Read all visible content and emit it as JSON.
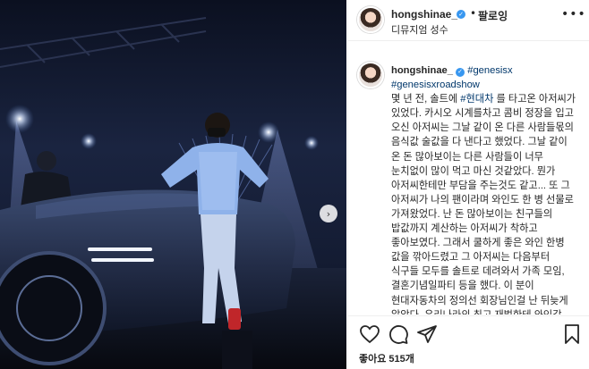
{
  "post": {
    "username": "hongshinae_",
    "verified_mark": "✓",
    "separator": "•",
    "follow_label": "팔로잉",
    "location": "디뮤지엄 성수",
    "more_icon": "more-options-icon",
    "next_arrow": "›"
  },
  "caption": {
    "username": "hongshinae_",
    "hashtags": "#genesisx",
    "hashtag_line2": "#genesisxroadshow",
    "body_part1": "몇 년 전, 솔트에 ",
    "body_tag": "#현대차",
    "body_part2": " 를 타고온 아저씨가 있었다. 카시오 시계를차고 콤비 정장을 입고 오신 아저씨는 그날 같이 온 다른 사람들몫의 음식값 술값을 다 낸다고 했었다. 그날 같이 온 돈 많아보이는 다른 사람들이 너무 눈치없이 많이 먹고 마신 것같았다. 뭔가 아저씨한테만 부담을 주는것도 같고... 또 그 아저씨가 나의 팬이라며 와인도 한 병 선물로 가져왔었다. 난 돈 많아보이는 친구들의 밥값까지 계산하는 아저씨가 착하고 좋아보였다. 그래서 쿨하게 좋은 와인 한병 값을 깎아드렸고 그 아저씨는 다음부터 식구들 모두를 솔트로 데려와서 가족 모임, 결혼기념일파티 등을 했다. 이 분이 현대자동차의 정의선 회장님인걸 난 뒤늦게 알았다. 우리나라의 최고 재벌한테 와인값 음식값"
  },
  "actions": {
    "like_icon": "heart-icon",
    "comment_icon": "comment-icon",
    "share_icon": "share-icon",
    "save_icon": "bookmark-icon"
  },
  "likes": {
    "label": "좋아요 515개"
  }
}
